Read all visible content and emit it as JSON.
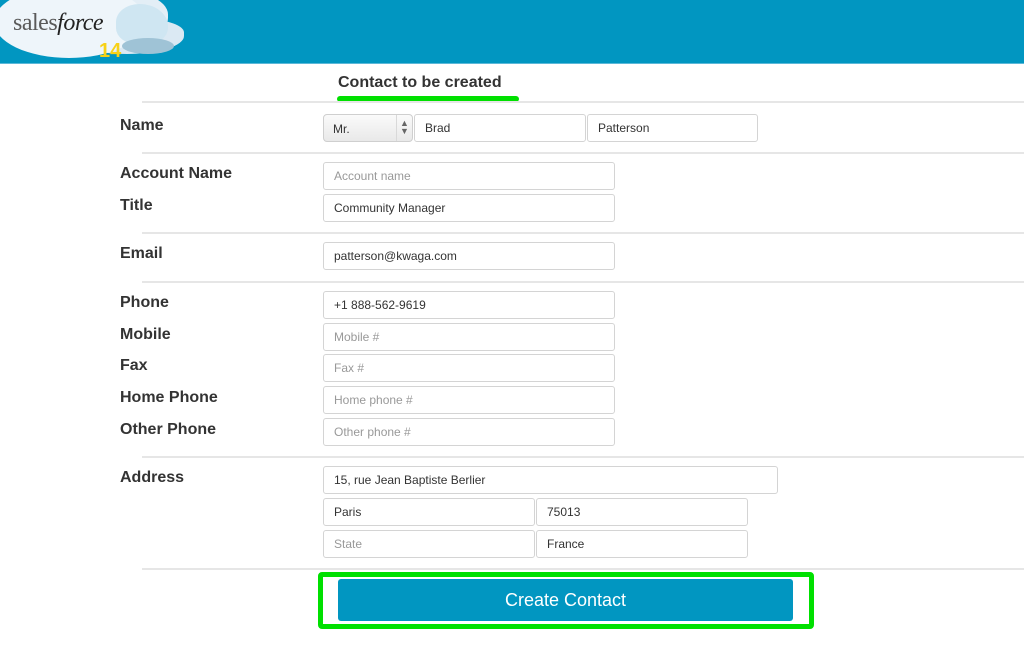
{
  "header": {
    "logo_text_plain": "sales",
    "logo_text_italic": "force",
    "logo_number": "14",
    "brand_color": "#0196c1"
  },
  "form": {
    "section_title": "Contact to be created",
    "highlight_color": "#00e000",
    "name": {
      "label": "Name",
      "salutation": "Mr.",
      "first_name": "Brad",
      "last_name": "Patterson"
    },
    "account_name": {
      "label": "Account Name",
      "value": "",
      "placeholder": "Account name"
    },
    "title": {
      "label": "Title",
      "value": "Community Manager",
      "placeholder": ""
    },
    "email": {
      "label": "Email",
      "value": "patterson@kwaga.com",
      "placeholder": ""
    },
    "phone": {
      "label": "Phone",
      "value": "+1 888-562-9619",
      "placeholder": ""
    },
    "mobile": {
      "label": "Mobile",
      "value": "",
      "placeholder": "Mobile #"
    },
    "fax": {
      "label": "Fax",
      "value": "",
      "placeholder": "Fax #"
    },
    "home_phone": {
      "label": "Home Phone",
      "value": "",
      "placeholder": "Home phone #"
    },
    "other_phone": {
      "label": "Other Phone",
      "value": "",
      "placeholder": "Other phone #"
    },
    "address": {
      "label": "Address",
      "street": "15, rue Jean Baptiste Berlier",
      "city": "Paris",
      "postal_code": "75013",
      "state": "",
      "state_placeholder": "State",
      "country": "France"
    },
    "submit_label": "Create Contact"
  }
}
